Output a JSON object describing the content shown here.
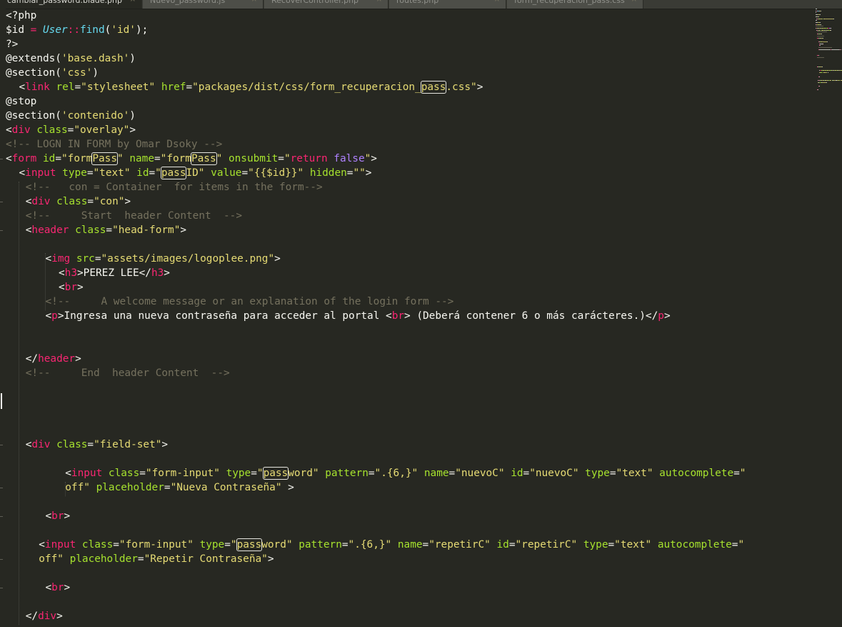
{
  "tabs": [
    {
      "label": "cambiar_password.blade.php",
      "active": true
    },
    {
      "label": "Nuevo_password.js",
      "active": false
    },
    {
      "label": "RecoverController.php",
      "active": false
    },
    {
      "label": "routes.php",
      "active": false
    },
    {
      "label": "form_recuperacion_pass.css",
      "active": false
    }
  ],
  "tab_close_glyph": "×",
  "colors": {
    "background": "#272822",
    "tag": "#f92672",
    "attribute": "#a6e22e",
    "string": "#e6db74",
    "comment": "#75715e",
    "keyword": "#f92672",
    "class": "#66d9ef",
    "constant": "#ae81ff",
    "plain": "#f8f8f2"
  },
  "code_lines": [
    {
      "indent": 0,
      "tokens": [
        [
          "plain",
          "<?php"
        ]
      ]
    },
    {
      "indent": 0,
      "tokens": [
        [
          "plain",
          "$id "
        ],
        [
          "kw",
          "="
        ],
        [
          "plain",
          " "
        ],
        [
          "cls",
          "User"
        ],
        [
          "kw",
          "::"
        ],
        [
          "func",
          "find"
        ],
        [
          "plain",
          "("
        ],
        [
          "str",
          "'id'"
        ],
        [
          "plain",
          ");"
        ]
      ]
    },
    {
      "indent": 0,
      "tokens": [
        [
          "plain",
          "?>"
        ]
      ]
    },
    {
      "indent": 0,
      "tokens": [
        [
          "plain",
          "@extends("
        ],
        [
          "str",
          "'base.dash'"
        ],
        [
          "plain",
          ")"
        ]
      ]
    },
    {
      "indent": 0,
      "tokens": [
        [
          "plain",
          "@section("
        ],
        [
          "str",
          "'css'"
        ],
        [
          "plain",
          ")"
        ]
      ]
    },
    {
      "indent": 2,
      "tokens": [
        [
          "plain",
          "<"
        ],
        [
          "tag",
          "link"
        ],
        [
          "plain",
          " "
        ],
        [
          "attr",
          "rel"
        ],
        [
          "plain",
          "="
        ],
        [
          "str",
          "\"stylesheet\""
        ],
        [
          "plain",
          " "
        ],
        [
          "attr",
          "href"
        ],
        [
          "plain",
          "="
        ],
        [
          "str",
          "\"packages/dist/css/form_recuperacion_"
        ],
        [
          "str-hl",
          "pass"
        ],
        [
          "str",
          ".css\""
        ],
        [
          "plain",
          ">"
        ]
      ]
    },
    {
      "indent": 0,
      "tokens": [
        [
          "plain",
          "@stop"
        ]
      ]
    },
    {
      "indent": 0,
      "tokens": [
        [
          "plain",
          "@section("
        ],
        [
          "str",
          "'contenido'"
        ],
        [
          "plain",
          ")"
        ]
      ]
    },
    {
      "indent": 0,
      "tokens": [
        [
          "plain",
          "<"
        ],
        [
          "tag",
          "div"
        ],
        [
          "plain",
          " "
        ],
        [
          "attr",
          "class"
        ],
        [
          "plain",
          "="
        ],
        [
          "str",
          "\"overlay\""
        ],
        [
          "plain",
          ">"
        ]
      ]
    },
    {
      "indent": 0,
      "tokens": [
        [
          "com",
          "<!-- LOGN IN FORM by Omar Dsoky -->"
        ]
      ]
    },
    {
      "indent": 0,
      "tokens": [
        [
          "plain",
          "<"
        ],
        [
          "tag",
          "form"
        ],
        [
          "plain",
          " "
        ],
        [
          "attr",
          "id"
        ],
        [
          "plain",
          "="
        ],
        [
          "str",
          "\"form"
        ],
        [
          "str-hl",
          "Pass"
        ],
        [
          "str",
          "\""
        ],
        [
          "plain",
          " "
        ],
        [
          "attr",
          "name"
        ],
        [
          "plain",
          "="
        ],
        [
          "str",
          "\"form"
        ],
        [
          "str-hl",
          "Pass"
        ],
        [
          "str",
          "\""
        ],
        [
          "plain",
          " "
        ],
        [
          "attr",
          "onsubmit"
        ],
        [
          "plain",
          "="
        ],
        [
          "str",
          "\""
        ],
        [
          "kw",
          "return"
        ],
        [
          "plain",
          " "
        ],
        [
          "const",
          "false"
        ],
        [
          "str",
          "\""
        ],
        [
          "plain",
          ">"
        ]
      ]
    },
    {
      "indent": 2,
      "tokens": [
        [
          "plain",
          "<"
        ],
        [
          "tag",
          "input"
        ],
        [
          "plain",
          " "
        ],
        [
          "attr",
          "type"
        ],
        [
          "plain",
          "="
        ],
        [
          "str",
          "\"text\""
        ],
        [
          "plain",
          " "
        ],
        [
          "attr",
          "id"
        ],
        [
          "plain",
          "="
        ],
        [
          "str",
          "\""
        ],
        [
          "str-hl",
          "pass"
        ],
        [
          "str",
          "ID\""
        ],
        [
          "plain",
          " "
        ],
        [
          "attr",
          "value"
        ],
        [
          "plain",
          "="
        ],
        [
          "str",
          "\"{{$id}}\""
        ],
        [
          "plain",
          " "
        ],
        [
          "attr",
          "hidden"
        ],
        [
          "plain",
          "="
        ],
        [
          "str",
          "\"\""
        ],
        [
          "plain",
          ">"
        ]
      ]
    },
    {
      "indent": 3,
      "tokens": [
        [
          "com",
          "<!--   con = Container  for items in the form-->"
        ]
      ]
    },
    {
      "indent": 3,
      "tokens": [
        [
          "plain",
          "<"
        ],
        [
          "tag",
          "div"
        ],
        [
          "plain",
          " "
        ],
        [
          "attr",
          "class"
        ],
        [
          "plain",
          "="
        ],
        [
          "str",
          "\"con\""
        ],
        [
          "plain",
          ">"
        ]
      ]
    },
    {
      "indent": 3,
      "tokens": [
        [
          "com",
          "<!--     Start  header Content  -->"
        ]
      ]
    },
    {
      "indent": 3,
      "tokens": [
        [
          "plain",
          "<"
        ],
        [
          "tag",
          "header"
        ],
        [
          "plain",
          " "
        ],
        [
          "attr",
          "class"
        ],
        [
          "plain",
          "="
        ],
        [
          "str",
          "\"head-form\""
        ],
        [
          "plain",
          ">"
        ]
      ]
    },
    {
      "indent": 0,
      "tokens": []
    },
    {
      "indent": 6,
      "tokens": [
        [
          "plain",
          "<"
        ],
        [
          "tag",
          "img"
        ],
        [
          "plain",
          " "
        ],
        [
          "attr",
          "src"
        ],
        [
          "plain",
          "="
        ],
        [
          "str",
          "\"assets/images/logoplee.png\""
        ],
        [
          "plain",
          ">"
        ]
      ]
    },
    {
      "indent": 8,
      "tokens": [
        [
          "plain",
          "<"
        ],
        [
          "tag",
          "h3"
        ],
        [
          "plain",
          ">PEREZ LEE</"
        ],
        [
          "tag",
          "h3"
        ],
        [
          "plain",
          ">"
        ]
      ]
    },
    {
      "indent": 8,
      "tokens": [
        [
          "plain",
          "<"
        ],
        [
          "tag",
          "br"
        ],
        [
          "plain",
          ">"
        ]
      ]
    },
    {
      "indent": 6,
      "tokens": [
        [
          "com",
          "<!--     A welcome message or an explanation of the login form -->"
        ]
      ]
    },
    {
      "indent": 6,
      "tokens": [
        [
          "plain",
          "<"
        ],
        [
          "tag",
          "p"
        ],
        [
          "plain",
          ">Ingresa una nueva contraseña para acceder al portal <"
        ],
        [
          "tag",
          "br"
        ],
        [
          "plain",
          "> (Deberá contener 6 o más carácteres.)</"
        ],
        [
          "tag",
          "p"
        ],
        [
          "plain",
          ">"
        ]
      ]
    },
    {
      "indent": 0,
      "tokens": []
    },
    {
      "indent": 0,
      "tokens": []
    },
    {
      "indent": 3,
      "tokens": [
        [
          "plain",
          "</"
        ],
        [
          "tag",
          "header"
        ],
        [
          "plain",
          ">"
        ]
      ]
    },
    {
      "indent": 3,
      "tokens": [
        [
          "com",
          "<!--     End  header Content  -->"
        ]
      ]
    },
    {
      "indent": 0,
      "tokens": []
    },
    {
      "indent": 0,
      "tokens": []
    },
    {
      "indent": 0,
      "tokens": []
    },
    {
      "indent": 0,
      "tokens": []
    },
    {
      "indent": 3,
      "tokens": [
        [
          "plain",
          "<"
        ],
        [
          "tag",
          "div"
        ],
        [
          "plain",
          " "
        ],
        [
          "attr",
          "class"
        ],
        [
          "plain",
          "="
        ],
        [
          "str",
          "\"field-set\""
        ],
        [
          "plain",
          ">"
        ]
      ]
    },
    {
      "indent": 0,
      "tokens": []
    },
    {
      "indent": 9,
      "tokens": [
        [
          "plain",
          "<"
        ],
        [
          "tag",
          "input"
        ],
        [
          "plain",
          " "
        ],
        [
          "attr",
          "class"
        ],
        [
          "plain",
          "="
        ],
        [
          "str",
          "\"form-input\""
        ],
        [
          "plain",
          " "
        ],
        [
          "attr",
          "type"
        ],
        [
          "plain",
          "="
        ],
        [
          "str",
          "\""
        ],
        [
          "str-hl",
          "pass"
        ],
        [
          "str",
          "word\""
        ],
        [
          "plain",
          " "
        ],
        [
          "attr",
          "pattern"
        ],
        [
          "plain",
          "="
        ],
        [
          "str",
          "\".{6,}\""
        ],
        [
          "plain",
          " "
        ],
        [
          "attr",
          "name"
        ],
        [
          "plain",
          "="
        ],
        [
          "str",
          "\"nuevoC\""
        ],
        [
          "plain",
          " "
        ],
        [
          "attr",
          "id"
        ],
        [
          "plain",
          "="
        ],
        [
          "str",
          "\"nuevoC\""
        ],
        [
          "plain",
          " "
        ],
        [
          "attr",
          "type"
        ],
        [
          "plain",
          "="
        ],
        [
          "str",
          "\"text\""
        ],
        [
          "plain",
          " "
        ],
        [
          "attr",
          "autocomplete"
        ],
        [
          "plain",
          "="
        ],
        [
          "str",
          "\""
        ]
      ]
    },
    {
      "indent": 9,
      "tokens": [
        [
          "str",
          "off\""
        ],
        [
          "plain",
          " "
        ],
        [
          "attr",
          "placeholder"
        ],
        [
          "plain",
          "="
        ],
        [
          "str",
          "\"Nueva Contraseña\""
        ],
        [
          "plain",
          " >"
        ]
      ]
    },
    {
      "indent": 0,
      "tokens": []
    },
    {
      "indent": 6,
      "tokens": [
        [
          "plain",
          "<"
        ],
        [
          "tag",
          "br"
        ],
        [
          "plain",
          ">"
        ]
      ]
    },
    {
      "indent": 0,
      "tokens": []
    },
    {
      "indent": 5,
      "tokens": [
        [
          "plain",
          "<"
        ],
        [
          "tag",
          "input"
        ],
        [
          "plain",
          " "
        ],
        [
          "attr",
          "class"
        ],
        [
          "plain",
          "="
        ],
        [
          "str",
          "\"form-input\""
        ],
        [
          "plain",
          " "
        ],
        [
          "attr",
          "type"
        ],
        [
          "plain",
          "="
        ],
        [
          "str",
          "\""
        ],
        [
          "str-hl",
          "pass"
        ],
        [
          "str",
          "word\""
        ],
        [
          "plain",
          " "
        ],
        [
          "attr",
          "pattern"
        ],
        [
          "plain",
          "="
        ],
        [
          "str",
          "\".{6,}\""
        ],
        [
          "plain",
          " "
        ],
        [
          "attr",
          "name"
        ],
        [
          "plain",
          "="
        ],
        [
          "str",
          "\"repetirC\""
        ],
        [
          "plain",
          " "
        ],
        [
          "attr",
          "id"
        ],
        [
          "plain",
          "="
        ],
        [
          "str",
          "\"repetirC\""
        ],
        [
          "plain",
          " "
        ],
        [
          "attr",
          "type"
        ],
        [
          "plain",
          "="
        ],
        [
          "str",
          "\"text\""
        ],
        [
          "plain",
          " "
        ],
        [
          "attr",
          "autocomplete"
        ],
        [
          "plain",
          "="
        ],
        [
          "str",
          "\""
        ]
      ]
    },
    {
      "indent": 5,
      "tokens": [
        [
          "str",
          "off\""
        ],
        [
          "plain",
          " "
        ],
        [
          "attr",
          "placeholder"
        ],
        [
          "plain",
          "="
        ],
        [
          "str",
          "\"Repetir Contraseña\""
        ],
        [
          "plain",
          ">"
        ]
      ]
    },
    {
      "indent": 0,
      "tokens": []
    },
    {
      "indent": 6,
      "tokens": [
        [
          "plain",
          "<"
        ],
        [
          "tag",
          "br"
        ],
        [
          "plain",
          ">"
        ]
      ]
    },
    {
      "indent": 0,
      "tokens": []
    },
    {
      "indent": 3,
      "tokens": [
        [
          "plain",
          "</"
        ],
        [
          "tag",
          "div"
        ],
        [
          "plain",
          ">"
        ]
      ]
    }
  ]
}
